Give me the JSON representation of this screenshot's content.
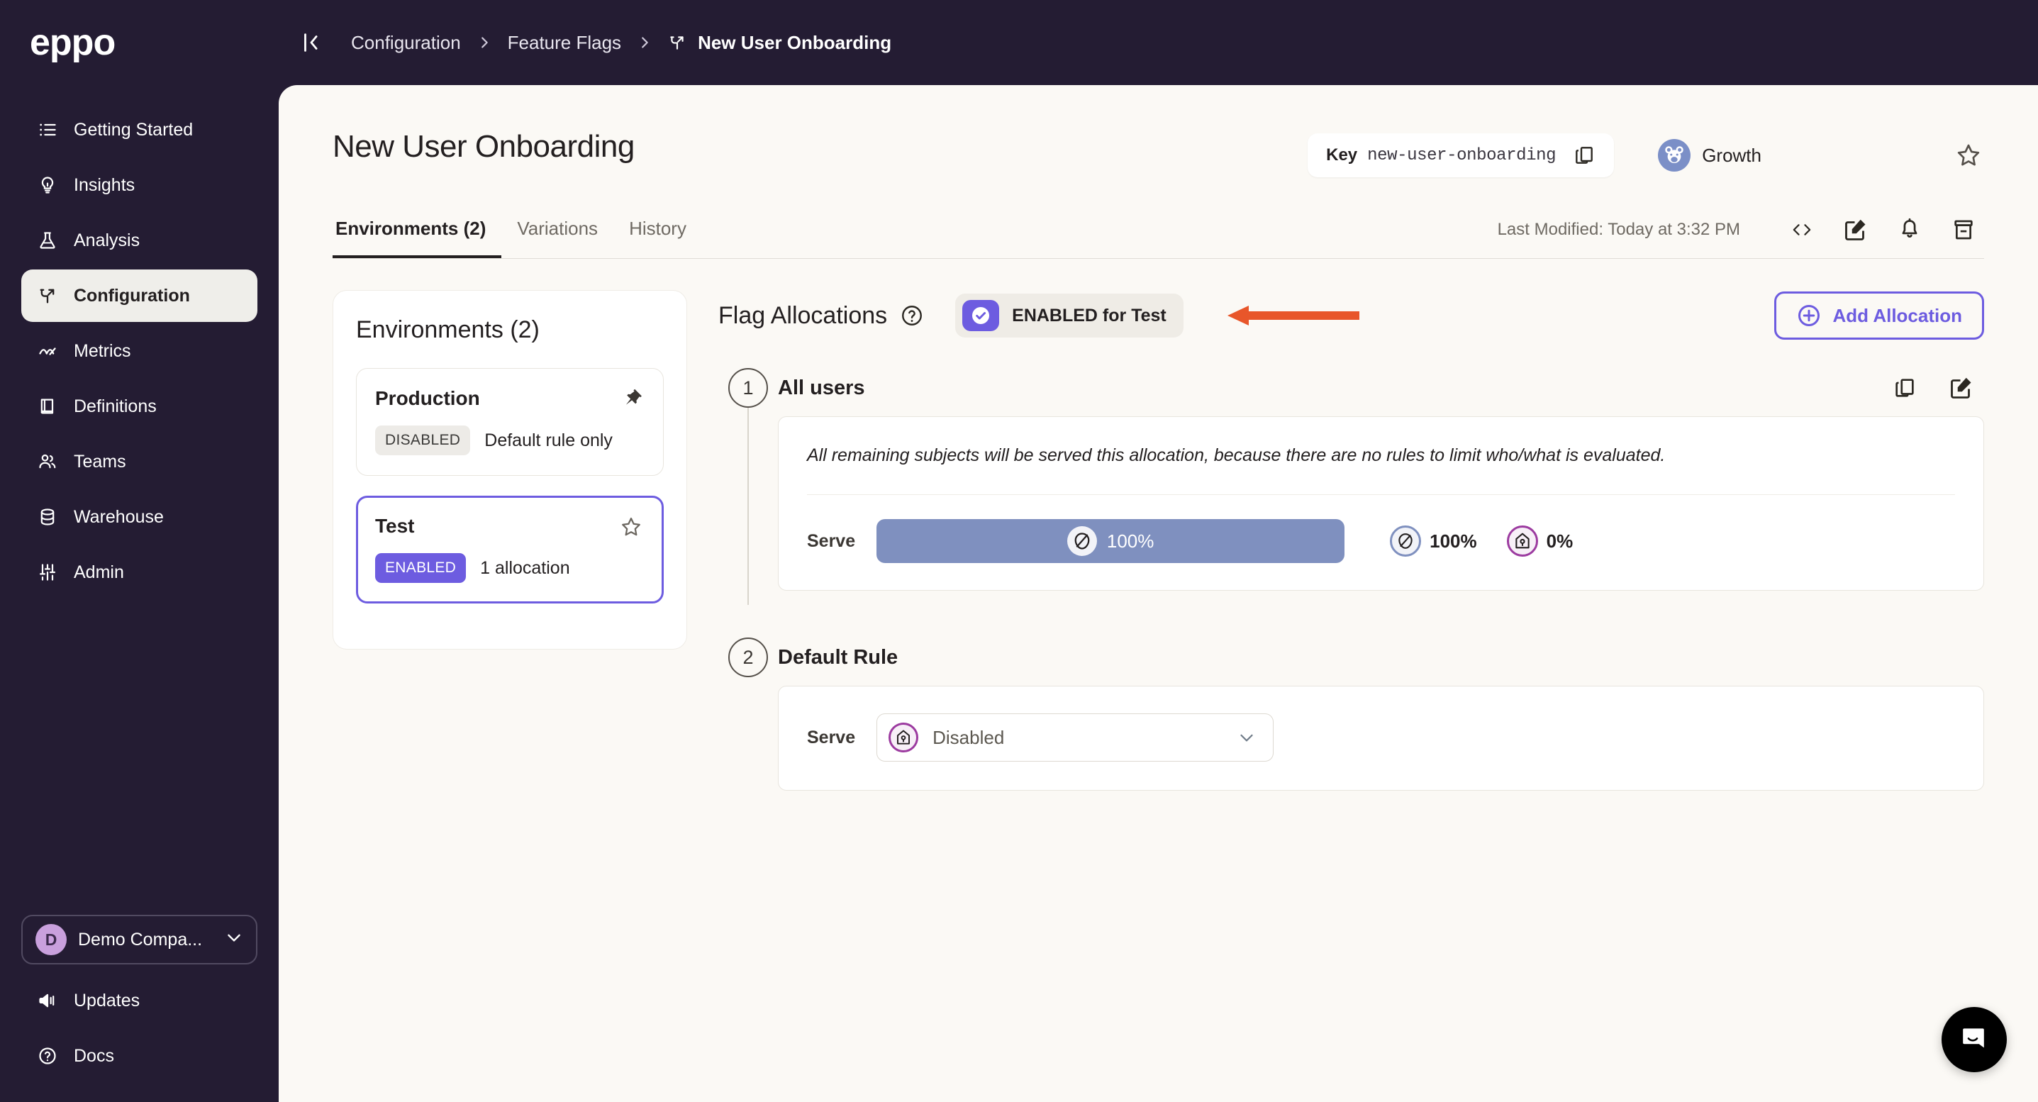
{
  "brand": {
    "name": "eppo"
  },
  "topbar": {
    "collapse_icon": "collapse-sidebar-icon",
    "breadcrumb": [
      {
        "label": "Configuration",
        "icon": null
      },
      {
        "label": "Feature Flags",
        "icon": null
      },
      {
        "label": "New User Onboarding",
        "icon": "feature-flag-icon"
      }
    ]
  },
  "sidebar": {
    "items": [
      {
        "label": "Getting Started",
        "icon": "list-icon",
        "active": false
      },
      {
        "label": "Insights",
        "icon": "lightbulb-icon",
        "active": false
      },
      {
        "label": "Analysis",
        "icon": "flask-icon",
        "active": false
      },
      {
        "label": "Configuration",
        "icon": "branch-icon",
        "active": true
      },
      {
        "label": "Metrics",
        "icon": "chart-line-icon",
        "active": false
      },
      {
        "label": "Definitions",
        "icon": "book-icon",
        "active": false
      },
      {
        "label": "Teams",
        "icon": "people-icon",
        "active": false
      },
      {
        "label": "Warehouse",
        "icon": "database-icon",
        "active": false
      },
      {
        "label": "Admin",
        "icon": "sliders-icon",
        "active": false
      }
    ],
    "org": {
      "initial": "D",
      "name": "Demo Compa...",
      "chevron": "chevron-down-icon"
    },
    "bottom_items": [
      {
        "label": "Updates",
        "icon": "megaphone-icon"
      },
      {
        "label": "Docs",
        "icon": "question-circle-icon"
      }
    ]
  },
  "page": {
    "title": "New User Onboarding",
    "key_label": "Key",
    "key_value": "new-user-onboarding",
    "copy_icon": "copy-icon",
    "team": {
      "name": "Growth",
      "avatar": "bear-avatar"
    },
    "favorite_icon": "star-outline-icon"
  },
  "tabs": {
    "items": [
      {
        "label": "Environments (2)",
        "active": true
      },
      {
        "label": "Variations",
        "active": false
      },
      {
        "label": "History",
        "active": false
      }
    ],
    "last_modified": "Last Modified: Today at 3:32 PM",
    "actions": [
      {
        "icon": "code-brackets-icon",
        "name": "code-snippet-button"
      },
      {
        "icon": "edit-square-icon",
        "name": "edit-button"
      },
      {
        "icon": "bell-icon",
        "name": "notifications-button"
      },
      {
        "icon": "archive-icon",
        "name": "archive-button"
      }
    ]
  },
  "environments": {
    "title": "Environments (2)",
    "items": [
      {
        "name": "Production",
        "status": "DISABLED",
        "status_kind": "disabled",
        "meta": "Default rule only",
        "corner_icon": "pin-icon",
        "selected": false
      },
      {
        "name": "Test",
        "status": "ENABLED",
        "status_kind": "enabled",
        "meta": "1 allocation",
        "corner_icon": "star-outline-icon",
        "selected": true
      }
    ]
  },
  "allocations": {
    "title": "Flag Allocations",
    "help_icon": "question-circle-icon",
    "toggle": {
      "label": "ENABLED for Test",
      "on": true,
      "icon": "check-circle-icon"
    },
    "annotation_arrow": {
      "color": "#e8562a",
      "direction": "left"
    },
    "add_button": {
      "label": "Add Allocation",
      "icon": "plus-circle-icon"
    },
    "steps": [
      {
        "number": "1",
        "title": "All users",
        "actions": [
          {
            "icon": "copy-icon",
            "name": "duplicate-allocation-button"
          },
          {
            "icon": "edit-square-icon",
            "name": "edit-allocation-button"
          }
        ],
        "note": "All remaining subjects will be served this allocation, because there are no rules to limit who/what is evaluated.",
        "serve_label": "Serve",
        "bar": {
          "percent": "100%",
          "width_pct": 100,
          "color": "#7f90bf",
          "icon": "acorn-slash-icon"
        },
        "legend": [
          {
            "percent": "100%",
            "icon": "acorn-slash-icon",
            "color": "#7f90bf"
          },
          {
            "percent": "0%",
            "icon": "birdhouse-icon",
            "color": "#9c3ba0"
          }
        ]
      },
      {
        "number": "2",
        "title": "Default Rule",
        "serve_label": "Serve",
        "select": {
          "value": "Disabled",
          "icon": "birdhouse-icon",
          "chevron": "chevron-down-icon"
        }
      }
    ]
  },
  "chat": {
    "icon": "chat-bubble-icon"
  },
  "colors": {
    "sidebar_bg": "#241c33",
    "canvas_bg": "#fbf9f5",
    "accent_purple": "#6d5ce0",
    "annotation_orange": "#e8562a",
    "bar_blue": "#7f90bf",
    "variation_purple": "#9c3ba0"
  }
}
